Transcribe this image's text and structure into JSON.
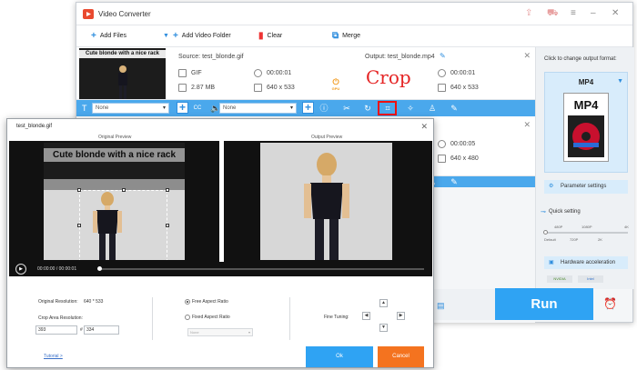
{
  "window": {
    "title": "Video Converter"
  },
  "toolbar": {
    "add_files": "Add Files",
    "add_folder": "Add Video Folder",
    "clear": "Clear",
    "merge": "Merge"
  },
  "file1": {
    "thumb_caption": "Cute blonde with a nice rack",
    "source": "Source: test_blonde.gif",
    "format": "GIF",
    "size": "2.87 MB",
    "duration": "00:00:01",
    "resolution": "640 x 533",
    "output": "Output: test_blonde.mp4",
    "out_duration": "00:00:01",
    "out_resolution": "640 x 533",
    "gpu_label": "GPU"
  },
  "file2": {
    "duration": "00:00:05",
    "resolution": "640 x 480"
  },
  "edit_bar": {
    "subtitle_value": "None",
    "audio_value": "None"
  },
  "annotation": {
    "crop_label": "Crop"
  },
  "right_panel": {
    "output_format_label": "Click to change output format:",
    "format_name": "MP4",
    "mp4_icon_text": "MP4",
    "param_settings": "Parameter settings",
    "quick_setting": "Quick setting",
    "res_top": [
      "480P",
      "1080P",
      "4K"
    ],
    "res_bottom": [
      "Default",
      "720P",
      "2K"
    ],
    "hw_accel": "Hardware acceleration",
    "gpu_vendors": [
      "NVIDIA",
      "Intel"
    ]
  },
  "run_button": "Run",
  "crop_dialog": {
    "title": "test_blonde.gif",
    "original_preview": "Original Preview",
    "output_preview": "Output Preview",
    "caption": "Cute blonde with a nice rack",
    "timecode": "00:00:00 / 00:00:01",
    "playback_progress": 0.0,
    "original_resolution_label": "Original Resolution:",
    "original_resolution_value": "640 * 533",
    "crop_area_label": "Crop Area Resolution:",
    "crop_width": "393",
    "crop_sep": "#",
    "crop_height": "334",
    "free_ratio": "Free Aspect Ratio",
    "fixed_ratio": "Fixed Aspect Ratio",
    "ratio_select": "None",
    "fine_tuning": "Fine Tuning:",
    "tutorial": "Tutorial >",
    "ok": "Ok",
    "cancel": "Cancel"
  }
}
